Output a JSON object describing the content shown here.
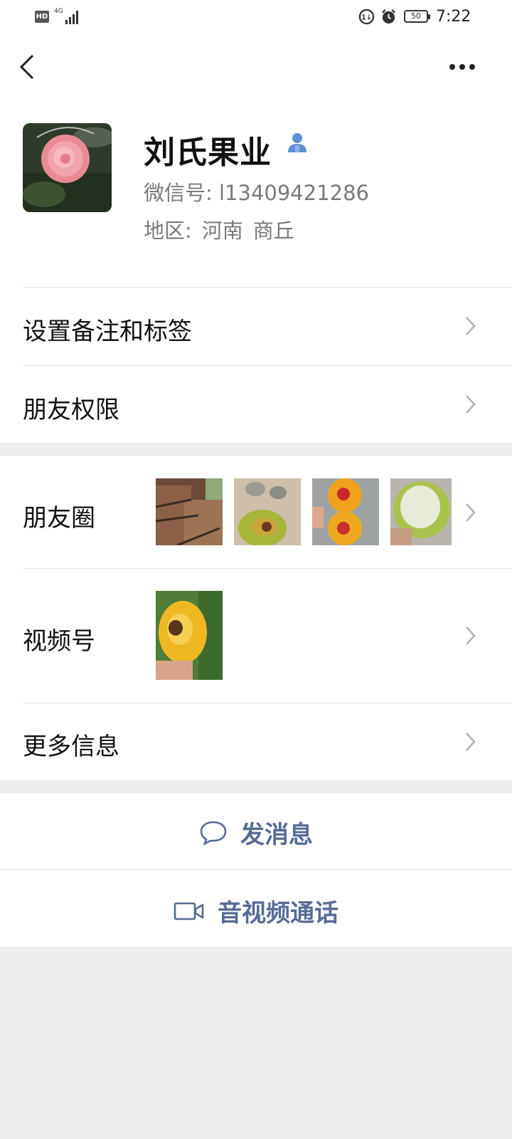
{
  "status_bar": {
    "hd": "HD",
    "network": "4G",
    "battery": "50",
    "time": "7:22"
  },
  "nav": {
    "back_icon": "chevron-left-icon",
    "more_icon": "more-dots-icon"
  },
  "profile": {
    "name": "刘氏果业",
    "wechat_id": "微信号: l13409421286",
    "region_label": "地区:",
    "region_province": "河南",
    "region_city": "商丘"
  },
  "rows": {
    "remark_tags": "设置备注和标签",
    "friend_permissions": "朋友权限",
    "moments": "朋友圈",
    "channels": "视频号",
    "more_info": "更多信息"
  },
  "actions": {
    "send_message": "发消息",
    "video_call": "音视频通话"
  },
  "colors": {
    "link_blue": "#576b95",
    "badge_blue": "#5b8fd6",
    "background": "#ededed"
  }
}
